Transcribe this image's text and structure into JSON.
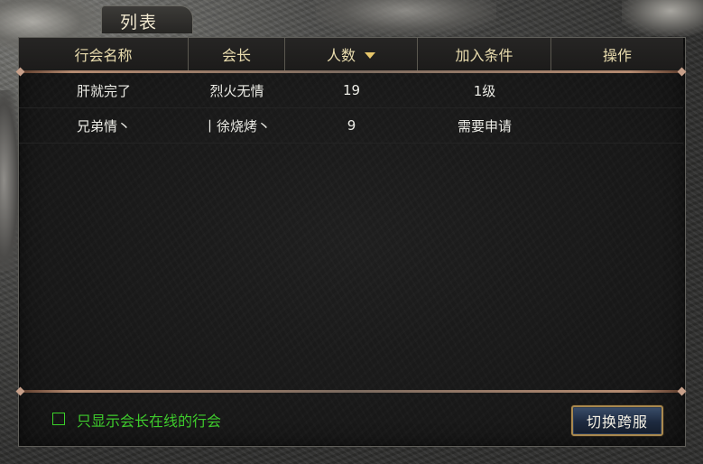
{
  "window": {
    "title": "列表"
  },
  "table": {
    "columns": [
      {
        "label": "行会名称"
      },
      {
        "label": "会长"
      },
      {
        "label": "人数"
      },
      {
        "label": "加入条件"
      },
      {
        "label": "操作"
      }
    ],
    "sorted_column": "人数",
    "rows": [
      {
        "name": "肝就完了",
        "leader": "烈火无情",
        "members": "19",
        "condition": "1级",
        "action": ""
      },
      {
        "name": "兄弟情丶",
        "leader": "丨徐烧烤丶",
        "members": "9",
        "condition": "需要申请",
        "action": ""
      }
    ]
  },
  "footer": {
    "checkbox_label": "只显示会长在线的行会",
    "checkbox_checked": false,
    "switch_button_label": "切换跨服"
  },
  "colors": {
    "header_text": "#e9dcae",
    "row_text": "#ecece6",
    "checkbox_green": "#3ecb2c",
    "sort_arrow": "#e7c66a",
    "button_border": "#a9894f"
  }
}
